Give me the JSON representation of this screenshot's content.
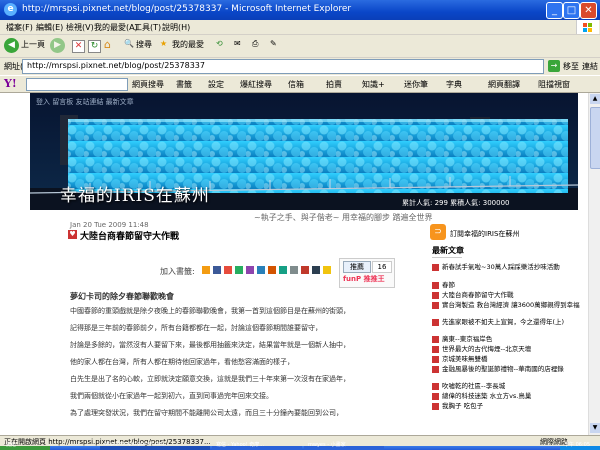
{
  "window": {
    "title": "http://mrspsi.pixnet.net/blog/post/25378337 - Microsoft Internet Explorer"
  },
  "menu": [
    "檔案(F)",
    "編輯(E)",
    "檢視(V)",
    "我的最愛(A)",
    "工具(T)",
    "說明(H)"
  ],
  "toolbar": {
    "back": "上一頁",
    "search": "搜尋",
    "favorites": "我的最愛"
  },
  "address": {
    "label": "網址(D)",
    "url": "http://mrspsi.pixnet.net/blog/post/25378337",
    "go": "移至",
    "links": "連結"
  },
  "yahoo_bar": {
    "logo": "Y!",
    "items": [
      "網頁搜尋",
      "書籤",
      "設定",
      "爆紅搜尋",
      "信箱",
      "拍賣",
      "知識+",
      "迷你筆",
      "字典",
      "網頁翻譯",
      "阻擋視窗"
    ]
  },
  "blog": {
    "banner_topleft": "登入  留言板  友站連結  最新文章",
    "title": "幸福的IRIS在蘇州",
    "stats": "累計人氣: 299  累積人氣: 300000",
    "subtitle": "~執子之手、與子偕老~  用幸福的腳步  踏遍全世界",
    "post_date": "Jan 20 Tue 2009 11:48",
    "post_title": "大陸台商春節留守大作戰",
    "bookmark_label": "加入書籤:",
    "push_label": "推薦",
    "push_count": "16",
    "funp": "funP 推推王",
    "subheading": "夢幻卡司的除夕春節聯歡晚會",
    "paragraphs": [
      "中國春節的重頭戲就是除夕夜晚上的春節聯歡晚會，我第一首到這個節目是在蘇州的街頭，",
      "記得那是三年前的春節前夕，所有台籍都都在一起，討論這個春節期間誰要留守，",
      "討論是多餘的，當然沒有人要留下來，最後都用抽籤來決定，結果當年就是一個新人抽中，",
      "他的家人都在台灣，所有人都在期待他回家過年，看他愁容滿面的樣子，",
      "白先生是出了名的心軟，立即就決定願意交換，這就是我們三十年來第一次沒有在家過年，",
      "我們兩個就從小在家過年一起到初六，直到同事過完年回來交接。",
      "為了處理突發狀況，我們在留守期間不能離開公司太遠，而且三十分鐘內要能回到公司，"
    ],
    "sidebar": {
      "rss": "訂閱幸福的IRIS在蘇州",
      "heading": "最新文章",
      "posts": [
        "新春試手氣啦~30萬人踩踩樂活抄味活動",
        "春節",
        "大陸台商春節留守大作戰",
        "實台灣製造 救台灣經濟 讓3600萬鄉親得到幸福",
        "先進家眼被不如夫上宣賀，今之還得年(上)",
        "廣東--東京福岸色",
        "世界最大的古代悔煙--北京天壇",
        "京城美味無雙橋",
        "金融風暴後的聖誕節禮物--華南國的店裡錄",
        "吹噓乾的社區--李長城",
        "總偉的科技迷築 水立方vs.鳥巢",
        "我胸子 吃包子"
      ]
    }
  },
  "status": {
    "text": "正在開啟網頁 http://mrspsi.pixnet.net/blog/post/25378337...",
    "zone": "網際網路"
  },
  "taskbar": [
    "開始",
    "http://mrspsi.pixnet.net/...",
    "寫信 - Yahoo! 奇摩...",
    "mwyes - 小畫家"
  ],
  "clock": "下午 06:05",
  "colors": {
    "accent": "#0a46c8",
    "post_title": "#000000",
    "link": "#333333",
    "banner_pool": "#1bb6e8"
  }
}
